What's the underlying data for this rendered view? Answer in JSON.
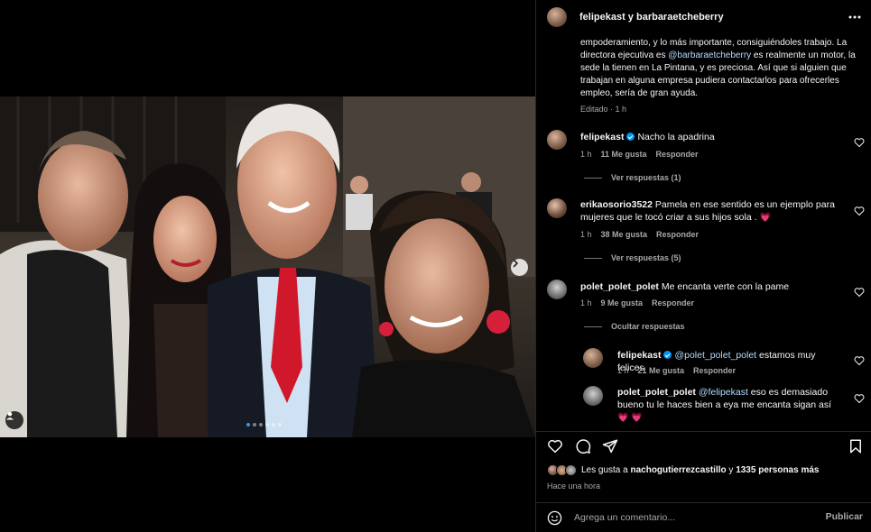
{
  "header": {
    "users": "felipekast y barbaraetcheberry"
  },
  "caption": {
    "part1": "empoderamiento, y lo más importante, consiguiéndoles trabajo. La directora ejecutiva es ",
    "mention": "@barbaraetcheberry",
    "part2": " es realmente un motor, la sede la tienen en La Pintana, y es preciosa. Así que si alguien que trabajan en alguna empresa pudiera contactarlos para ofrecerles empleo, sería de gran ayuda.",
    "meta": "Editado · 1 h"
  },
  "comments": [
    {
      "user": "felipekast",
      "text": "Nacho la apadrina",
      "time": "1 h",
      "likes": "11 Me gusta",
      "reply": "Responder",
      "replies_toggle": "Ver respuestas (1)"
    },
    {
      "user": "erikaosorio3522",
      "text": "Pamela en ese sentido es un ejemplo para mujeres que le tocó criar a sus hijos sola .",
      "heart": "💗",
      "time": "1 h",
      "likes": "38 Me gusta",
      "reply": "Responder",
      "replies_toggle": "Ver respuestas (5)"
    },
    {
      "user": "polet_polet_polet",
      "text": "Me encanta verte con la pame",
      "time": "1 h",
      "likes": "9 Me gusta",
      "reply": "Responder",
      "replies_toggle": "Ocultar respuestas"
    }
  ],
  "replies": [
    {
      "user": "felipekast",
      "mention": "@polet_polet_polet",
      "text": " estamos muy felices",
      "time": "1 h",
      "likes": "21 Me gusta",
      "reply": "Responder"
    },
    {
      "user": "polet_polet_polet",
      "mention": "@felipekast",
      "text": " eso es demasiado bueno tu le haces bien a eya me encanta sigan así",
      "hearts": "💗 💗"
    }
  ],
  "likes": {
    "prefix": "Les gusta a ",
    "user": "nachogutierrezcastillo",
    "middle": " y ",
    "count": "1335 personas más"
  },
  "time_ago": "Hace una hora",
  "comment_box": {
    "placeholder": "Agrega un comentario...",
    "publish": "Publicar"
  },
  "carousel": {
    "total_slides": 6,
    "active_index": 0
  },
  "colors": {
    "background": "#000000",
    "accent_blue": "#0095f6",
    "mention": "#b3dbff",
    "heart": "#ff3e73",
    "muted": "#a8a8a8"
  },
  "icons": [
    "more-icon",
    "heart-icon",
    "comment-icon",
    "share-icon",
    "bookmark-icon",
    "emoji-icon",
    "chevron-right-icon",
    "tag-user-icon",
    "verified-icon"
  ]
}
